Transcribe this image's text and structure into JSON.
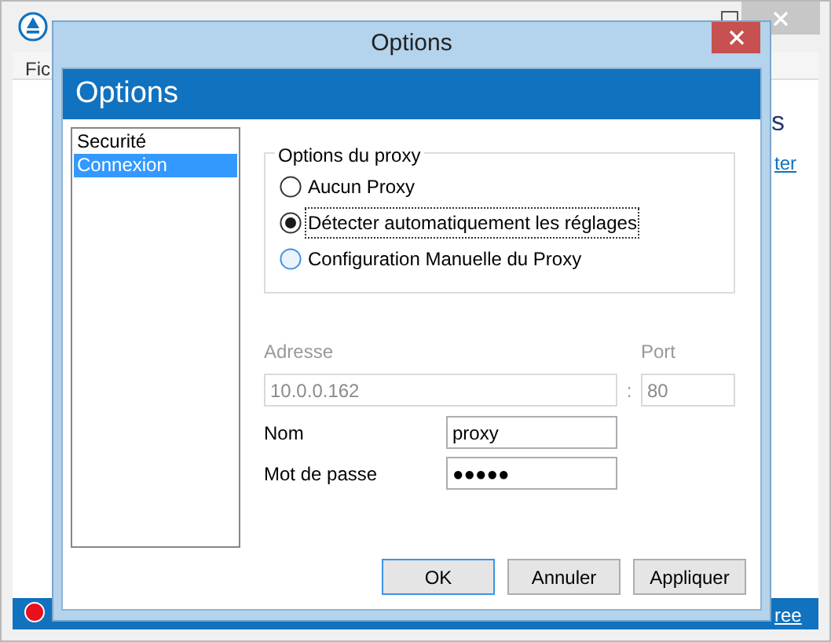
{
  "background_window": {
    "menu_item": "Fic",
    "heading_fragment": "s",
    "link_top": "ter",
    "link_bottom": "ree"
  },
  "dialog": {
    "title": "Options",
    "header": "Options",
    "categories": [
      {
        "label": "Securité",
        "selected": false
      },
      {
        "label": "Connexion",
        "selected": true
      }
    ],
    "proxy_group": {
      "title": "Options du proxy",
      "options": [
        {
          "label": "Aucun Proxy",
          "selected": false,
          "focused": false,
          "hovered": false
        },
        {
          "label": "Détecter automatiquement les réglages",
          "selected": true,
          "focused": true,
          "hovered": false
        },
        {
          "label": "Configuration Manuelle du Proxy",
          "selected": false,
          "focused": false,
          "hovered": true
        }
      ]
    },
    "address": {
      "label": "Adresse",
      "value": "10.0.0.162",
      "disabled": true
    },
    "separator": ":",
    "port": {
      "label": "Port",
      "value": "80",
      "disabled": true
    },
    "username": {
      "label": "Nom",
      "value": "proxy",
      "disabled": false
    },
    "password": {
      "label": "Mot de passe",
      "value": "●●●●●",
      "disabled": false
    },
    "buttons": [
      {
        "label": "OK",
        "default": true
      },
      {
        "label": "Annuler",
        "default": false
      },
      {
        "label": "Appliquer",
        "default": false
      }
    ]
  }
}
